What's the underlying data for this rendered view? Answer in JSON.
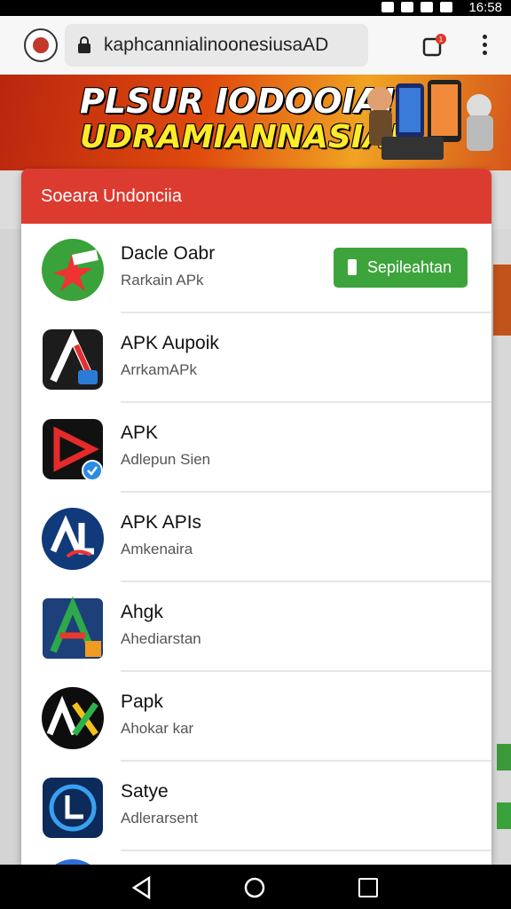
{
  "status_bar": {
    "time": "16:58"
  },
  "browser": {
    "url": "kaphcannialinoonesiusaAD",
    "tab_count": "1"
  },
  "banner": {
    "line1": "PLSUR IODOOIA!",
    "line2": "UDRAMIANNASIA!"
  },
  "dialog": {
    "title": "Soeara Undonciia",
    "install_label": "Sepileahtan",
    "apps": [
      {
        "name": "Dacle Oabr",
        "sub": "Rarkain APk",
        "icon": "green-star-icon"
      },
      {
        "name": "APK Aupoik",
        "sub": "ArrkamAPk",
        "icon": "a-logo-icon"
      },
      {
        "name": "APK",
        "sub": "Adlepun Sien",
        "icon": "play-triangle-icon"
      },
      {
        "name": "APK APIs",
        "sub": "Amkenaira",
        "icon": "al-logo-icon"
      },
      {
        "name": "Ahgk",
        "sub": "Ahediarstan",
        "icon": "a-colored-icon"
      },
      {
        "name": "Papk",
        "sub": "Ahokar kar",
        "icon": "ax-logo-icon"
      },
      {
        "name": "Satye",
        "sub": "Adlerarsent",
        "icon": "circle-l-icon"
      }
    ]
  },
  "colors": {
    "header_red": "#dc3b30",
    "install_green": "#3da43c"
  }
}
